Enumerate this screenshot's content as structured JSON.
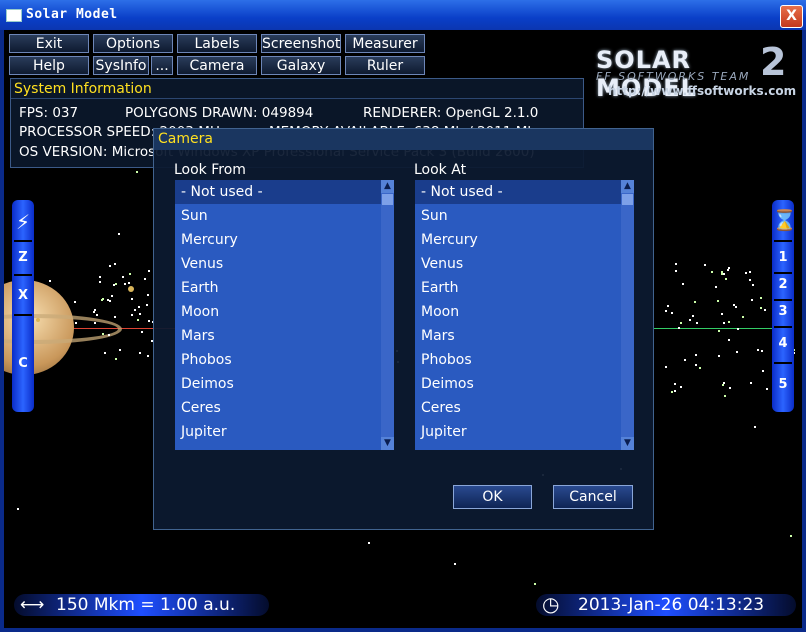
{
  "window": {
    "title": "Solar Model",
    "close_label": "X"
  },
  "menu": {
    "row1": [
      "Exit",
      "Options",
      "Labels",
      "Screenshot",
      "Measurer"
    ],
    "row2": [
      "Help",
      "SysInfo",
      "...",
      "Camera",
      "Galaxy",
      "Ruler"
    ]
  },
  "sysinfo": {
    "header": "System Information",
    "fps": "FPS:  037",
    "polygons": "POLYGONS DRAWN:  049894",
    "renderer": "RENDERER:  OpenGL 2.1.0",
    "processor": "PROCESSOR SPEED:  2003 MHz",
    "memory": "MEMORY AVAILABLE:  638 Mb / 2011 Mb",
    "os": "OS VERSION:  Microsoft Windows XP Professional Service Pack 3 (Build 2600)"
  },
  "logo": {
    "title": "SOLAR MODEL",
    "version": "2",
    "team": "FF SOFTWORKS TEAM",
    "url": "http://www.ffsoftworks.com"
  },
  "left_sidebar": {
    "icon": "lightning-icon",
    "buttons": [
      "Z",
      "X",
      "C"
    ]
  },
  "right_sidebar": {
    "icon": "hourglass-icon",
    "buttons": [
      "1",
      "2",
      "3",
      "4",
      "5"
    ]
  },
  "camera_dialog": {
    "title": "Camera",
    "look_from_label": "Look From",
    "look_at_label": "Look At",
    "look_from_items": [
      "- Not used -",
      "Sun",
      "Mercury",
      "Venus",
      "Earth",
      "Moon",
      "Mars",
      "Phobos",
      "Deimos",
      "Ceres",
      "Jupiter"
    ],
    "look_at_items": [
      "- Not used -",
      "Sun",
      "Mercury",
      "Venus",
      "Earth",
      "Moon",
      "Mars",
      "Phobos",
      "Deimos",
      "Ceres",
      "Jupiter"
    ],
    "selected_from": "- Not used -",
    "selected_at": "- Not used -",
    "ok_label": "OK",
    "cancel_label": "Cancel"
  },
  "status": {
    "scale": "150 Mkm = 1.00 a.u.",
    "datetime": "2013-Jan-26 04:13:23"
  },
  "colors": {
    "accent": "#ffe020",
    "window_frame": "#0a2a8a",
    "list_bg": "#2a5ac0"
  }
}
